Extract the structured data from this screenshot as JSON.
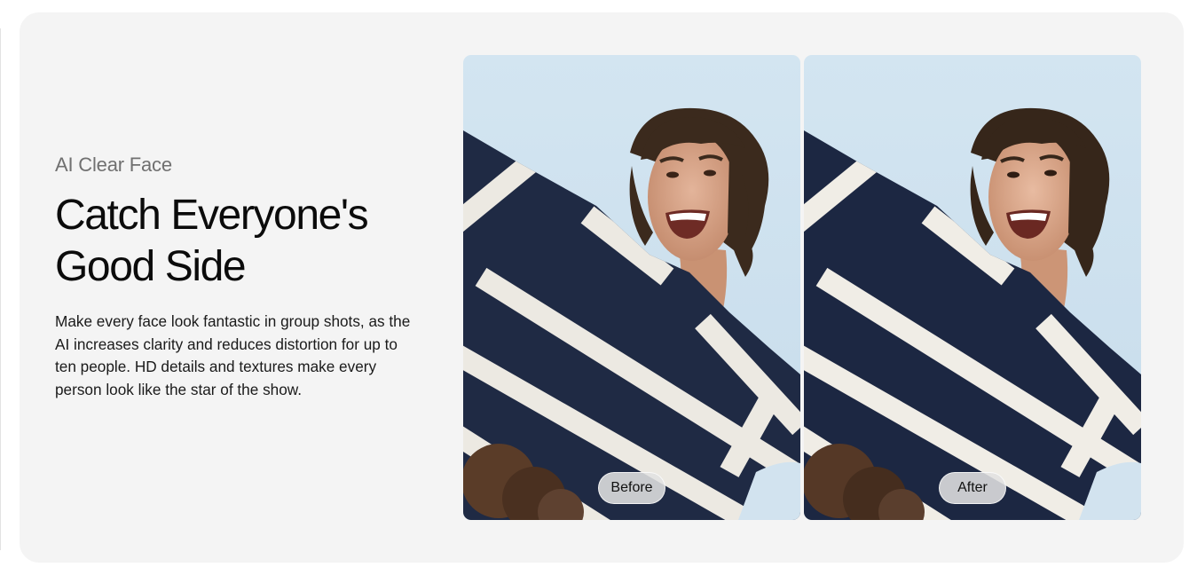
{
  "feature": {
    "eyebrow": "AI Clear Face",
    "headline_line1": "Catch Everyone's",
    "headline_line2": "Good Side",
    "description": "Make every face look fantastic in group shots, as the AI increases clarity and reduces distortion for up to ten people. HD details and textures make every person look like the star of the show."
  },
  "comparison": {
    "before_label": "Before",
    "after_label": "After"
  },
  "colors": {
    "card_background": "#f4f4f4",
    "sky": "#cfe1ee",
    "sweater_navy": "#1f2a44",
    "stripe": "#ece9e2",
    "hair": "#3b2a1d"
  }
}
